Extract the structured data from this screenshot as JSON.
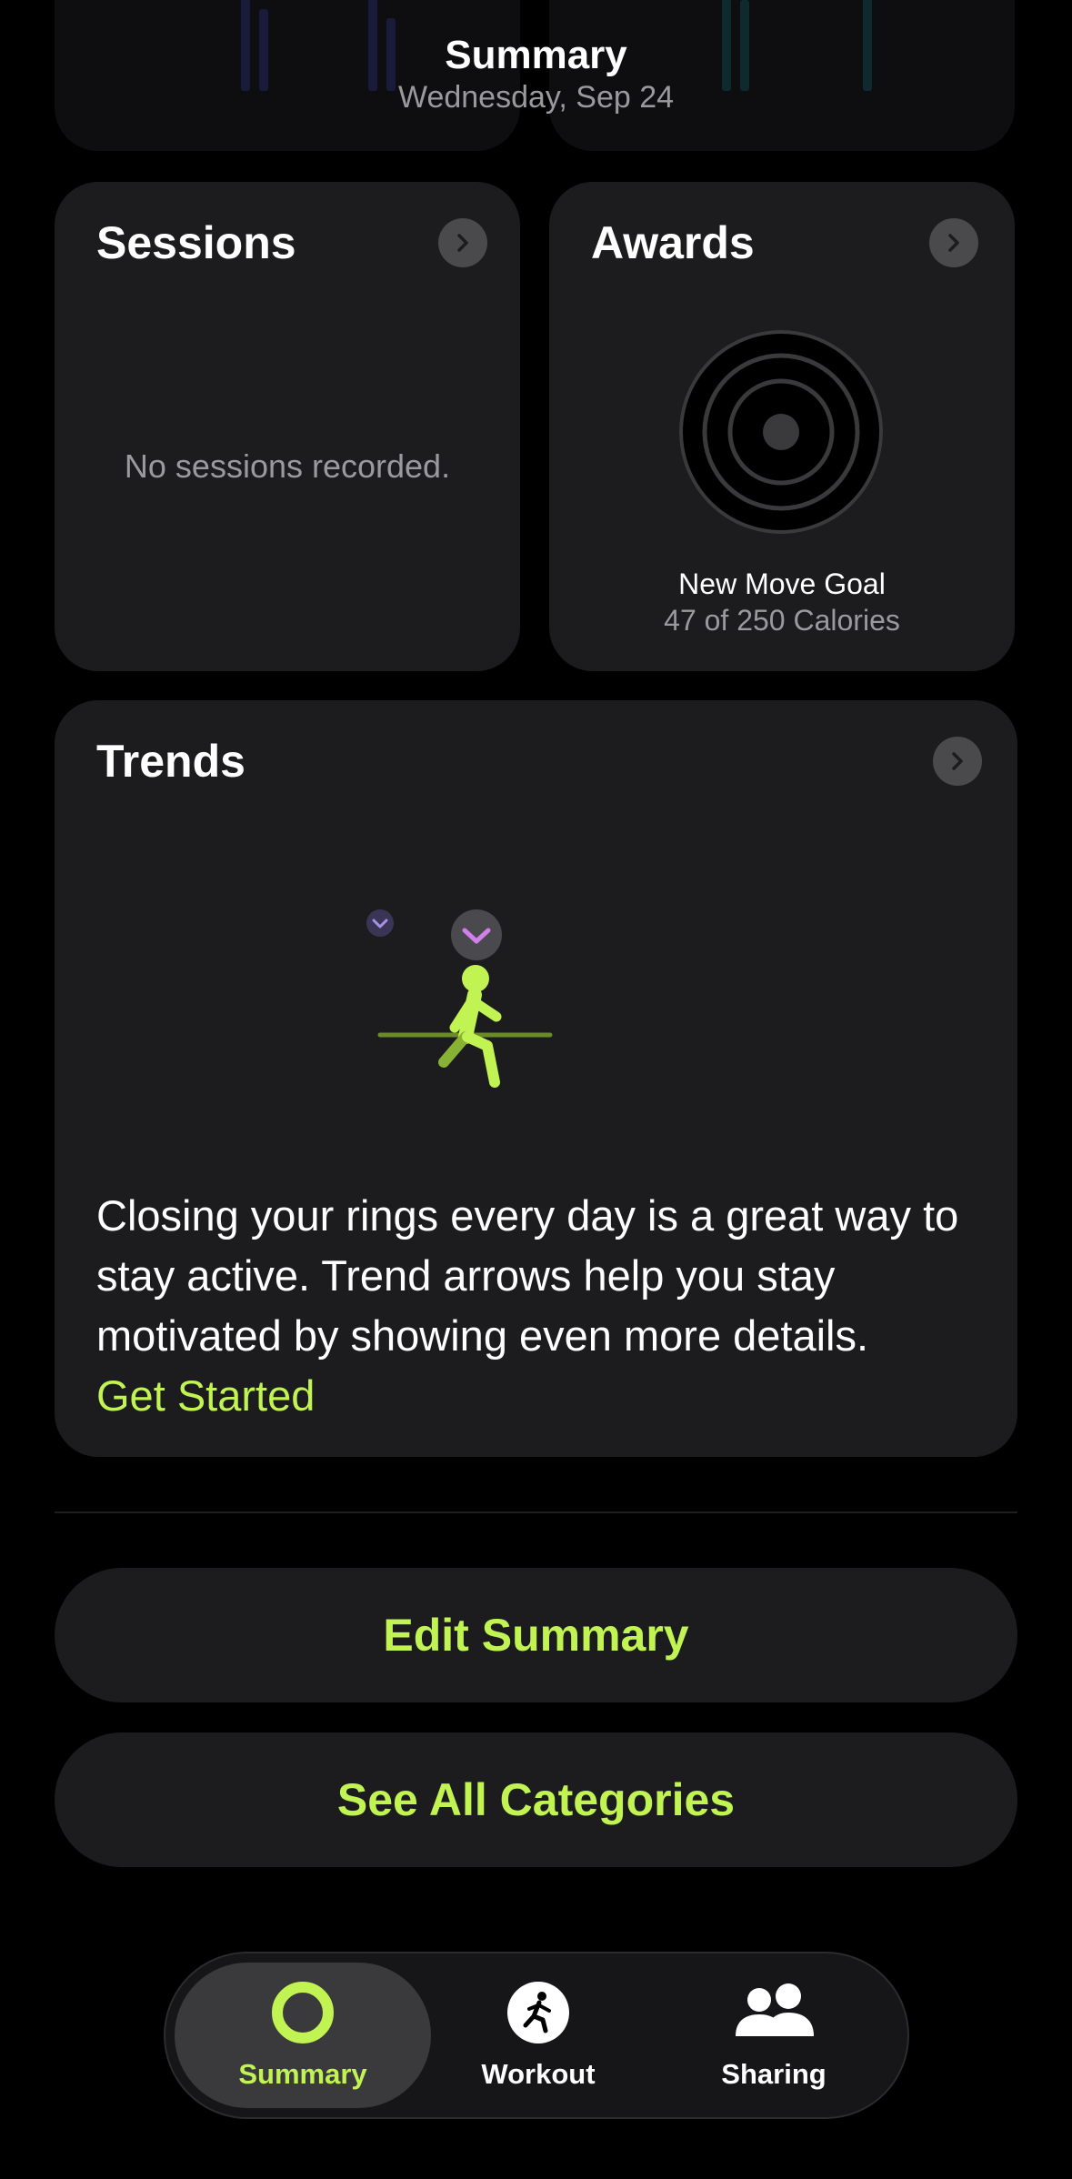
{
  "header": {
    "title": "Summary",
    "subtitle": "Wednesday, Sep 24"
  },
  "sessions": {
    "title": "Sessions",
    "empty_text": "No sessions recorded."
  },
  "awards": {
    "title": "Awards",
    "award_name": "New Move Goal",
    "award_detail": "47 of 250 Calories"
  },
  "trends": {
    "title": "Trends",
    "description": "Closing your rings every day is a great way to stay active. Trend arrows help you stay motivated by showing even more details.",
    "link": "Get Started"
  },
  "buttons": {
    "edit_summary": "Edit Summary",
    "see_all_categories": "See All Categories"
  },
  "tabbar": {
    "tabs": [
      {
        "label": "Summary",
        "icon": "activity-ring-icon",
        "selected": true
      },
      {
        "label": "Workout",
        "icon": "running-figure-icon",
        "selected": false
      },
      {
        "label": "Sharing",
        "icon": "people-icon",
        "selected": false
      }
    ]
  },
  "colors": {
    "accent": "#c1f453",
    "card": "#1c1c1e",
    "background": "#000000",
    "secondary_text": "#9a9a9e"
  }
}
